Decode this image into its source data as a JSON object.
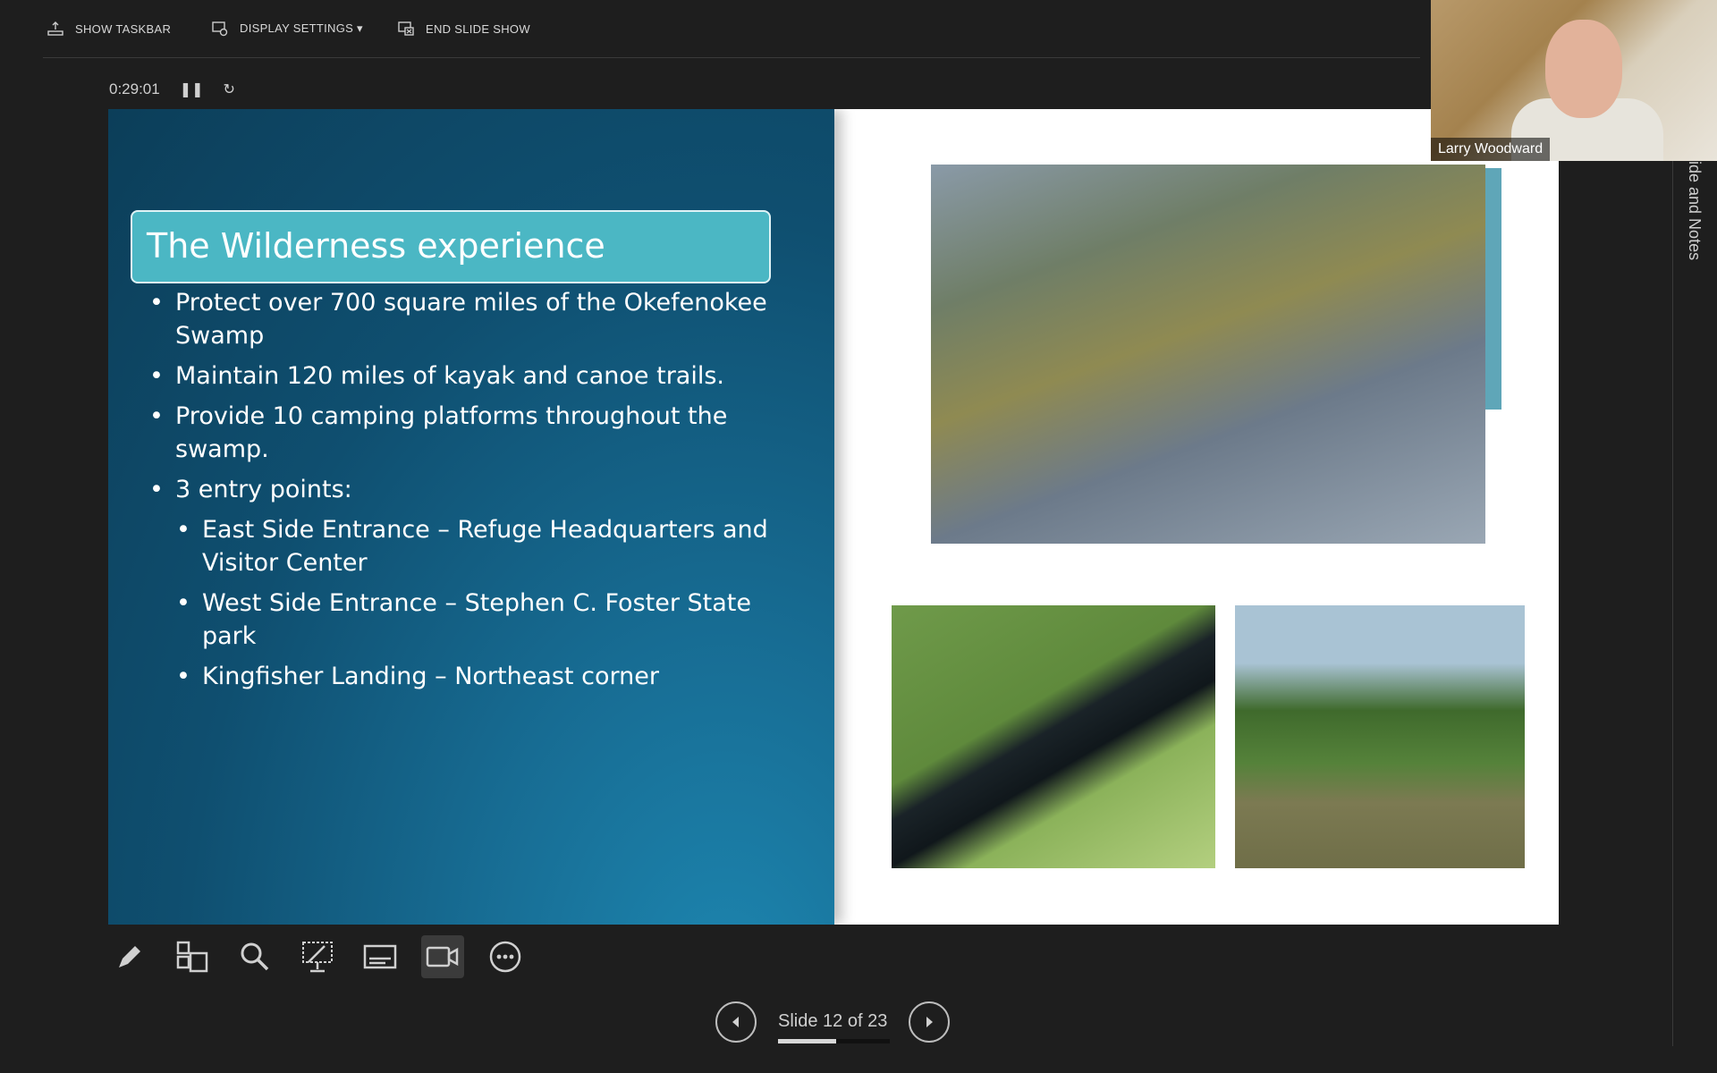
{
  "toolbar": {
    "show_taskbar": "SHOW TASKBAR",
    "display_settings": "DISPLAY SETTINGS ▾",
    "end_slide_show": "END SLIDE SHOW"
  },
  "timer": {
    "elapsed": "0:29:01",
    "pause_icon": "pause-icon",
    "restart_icon": "restart-icon"
  },
  "slide": {
    "title": "The Wilderness experience",
    "bullets": [
      "Protect over 700 square miles of the Okefenokee Swamp",
      "Maintain 120 miles of kayak and canoe trails.",
      "Provide 10 camping platforms throughout the swamp.",
      "3 entry points:"
    ],
    "sub_bullets": [
      "East Side Entrance – Refuge Headquarters and Visitor Center",
      "West Side Entrance – Stephen C. Foster State park",
      "Kingfisher Landing – Northeast corner"
    ],
    "accent": "#4bb7c4"
  },
  "webcam": {
    "participant_name": "Larry Woodward"
  },
  "side_panel": {
    "label": "ide and Notes"
  },
  "tools": [
    "pen-icon",
    "slides-grid-icon",
    "zoom-icon",
    "pointer-icon",
    "subtitles-icon",
    "camera-icon",
    "more-icon"
  ],
  "navigation": {
    "slide_label": "Slide 12 of 23",
    "current": 12,
    "total": 23,
    "progress_fraction": 0.52
  }
}
